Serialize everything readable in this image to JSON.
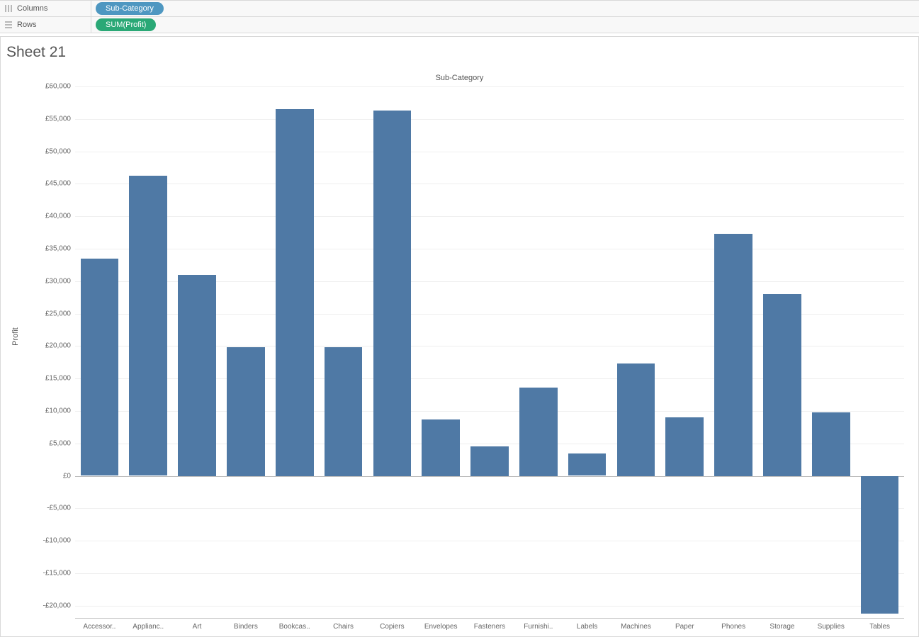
{
  "shelves": {
    "columns": {
      "label": "Columns",
      "pill": "Sub-Category"
    },
    "rows": {
      "label": "Rows",
      "pill": "SUM(Profit)"
    }
  },
  "sheet": {
    "title": "Sheet 21"
  },
  "chart_data": {
    "type": "bar",
    "title_top": "Sub-Category",
    "ylabel": "Profit",
    "ylim": [
      -22000,
      60000
    ],
    "y_ticks": [
      -20000,
      -15000,
      -10000,
      -5000,
      0,
      5000,
      10000,
      15000,
      20000,
      25000,
      30000,
      35000,
      40000,
      45000,
      50000,
      55000,
      60000
    ],
    "y_tick_labels": [
      "-£20,000",
      "-£15,000",
      "-£10,000",
      "-£5,000",
      "£0",
      "£5,000",
      "£10,000",
      "£15,000",
      "£20,000",
      "£25,000",
      "£30,000",
      "£35,000",
      "£40,000",
      "£45,000",
      "£50,000",
      "£55,000",
      "£60,000"
    ],
    "categories": [
      "Accessories",
      "Appliances",
      "Art",
      "Binders",
      "Bookcases",
      "Chairs",
      "Copiers",
      "Envelopes",
      "Fasteners",
      "Furnishings",
      "Labels",
      "Machines",
      "Paper",
      "Phones",
      "Storage",
      "Supplies",
      "Tables"
    ],
    "category_labels": [
      "Accessor..",
      "Applianc..",
      "Art",
      "Binders",
      "Bookcas..",
      "Chairs",
      "Copiers",
      "Envelopes",
      "Fasteners",
      "Furnishi..",
      "Labels",
      "Machines",
      "Paper",
      "Phones",
      "Storage",
      "Supplies",
      "Tables"
    ],
    "values": [
      33500,
      46200,
      31000,
      19800,
      56500,
      19800,
      56300,
      8700,
      4500,
      13600,
      3400,
      17300,
      9000,
      37300,
      28000,
      9800,
      -21200
    ]
  }
}
